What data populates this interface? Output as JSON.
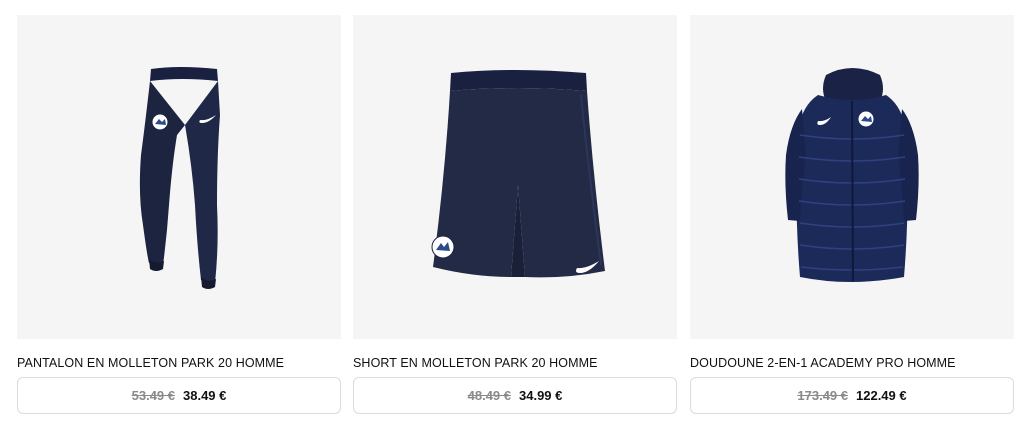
{
  "products": [
    {
      "name": "PANTALON EN MOLLETON PARK 20 HOMME",
      "old_price": "53.49 €",
      "price": "38.49 €",
      "image_icon": "navy-jogging-pants-icon"
    },
    {
      "name": "SHORT EN MOLLETON PARK 20 HOMME",
      "old_price": "48.49 €",
      "price": "34.99 €",
      "image_icon": "navy-shorts-icon"
    },
    {
      "name": "DOUDOUNE 2-EN-1 ACADEMY PRO HOMME",
      "old_price": "173.49 €",
      "price": "122.49 €",
      "image_icon": "navy-long-puffer-jacket-icon"
    }
  ],
  "colors": {
    "navy": "#1c2440",
    "image_bg": "#f5f5f5",
    "border": "#dcdcdc",
    "strike": "#8a8a8a"
  }
}
